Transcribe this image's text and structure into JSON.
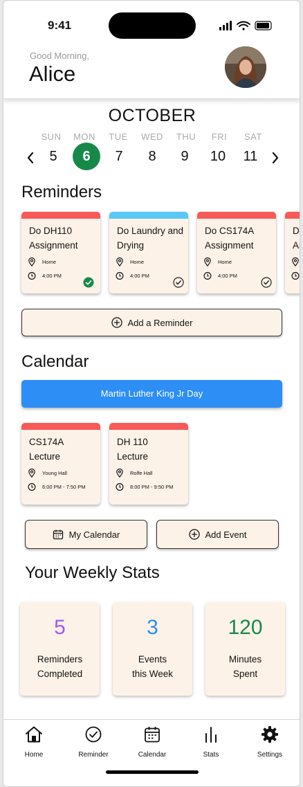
{
  "status": {
    "time": "9:41"
  },
  "header": {
    "greeting": "Good Morning,",
    "name": "Alice",
    "avatar": "user-avatar-photo"
  },
  "calendar_strip": {
    "month": "OCTOBER",
    "days": [
      {
        "dow": "SUN",
        "num": "5"
      },
      {
        "dow": "MON",
        "num": "6",
        "selected": true
      },
      {
        "dow": "TUE",
        "num": "7"
      },
      {
        "dow": "WED",
        "num": "8"
      },
      {
        "dow": "THU",
        "num": "9"
      },
      {
        "dow": "FRI",
        "num": "10"
      },
      {
        "dow": "SAT",
        "num": "11"
      }
    ],
    "selected_color": "#16894a"
  },
  "reminders": {
    "heading": "Reminders",
    "items": [
      {
        "title": "Do DH110 Assignment",
        "location": "Home",
        "time": "4:00 PM",
        "color": "#f75a57",
        "done": true
      },
      {
        "title": "Do Laundry and Drying",
        "location": "Home",
        "time": "4:00 PM",
        "color": "#5ac8f5",
        "done": false
      },
      {
        "title": "Do CS174A Assignment",
        "location": "Home",
        "time": "4:00 PM",
        "color": "#f75a57",
        "done": false
      },
      {
        "title": "Do",
        "subtitle": "As",
        "color": "#f75a57"
      }
    ],
    "add_label": "Add a Reminder"
  },
  "calendar": {
    "heading": "Calendar",
    "all_day_event": "Martin Luther King Jr Day",
    "event_color": "#2d8ef5",
    "events": [
      {
        "title": "CS174A Lecture",
        "location": "Young Hall",
        "time": "6:00 PM - 7:50 PM",
        "color": "#f75a57"
      },
      {
        "title": "DH 110 Lecture",
        "location": "Rolfe Hall",
        "time": "8:00 PM - 9:50 PM",
        "color": "#f75a57"
      }
    ],
    "my_calendar_label": "My Calendar",
    "add_event_label": "Add Event"
  },
  "stats": {
    "heading": "Your Weekly Stats",
    "items": [
      {
        "value": "5",
        "line1": "Reminders",
        "line2": "Completed",
        "color": "#a855f7"
      },
      {
        "value": "3",
        "line1": "Events",
        "line2": "this Week",
        "color": "#2d8ef5"
      },
      {
        "value": "120",
        "line1": "Minutes",
        "line2": "Spent",
        "color": "#16894a"
      }
    ]
  },
  "tabbar": {
    "items": [
      {
        "label": "Home",
        "icon": "home-icon"
      },
      {
        "label": "Reminder",
        "icon": "check-circle-icon"
      },
      {
        "label": "Calendar",
        "icon": "calendar-icon"
      },
      {
        "label": "Stats",
        "icon": "bar-stats-icon"
      },
      {
        "label": "Settings",
        "icon": "gear-icon"
      }
    ]
  }
}
